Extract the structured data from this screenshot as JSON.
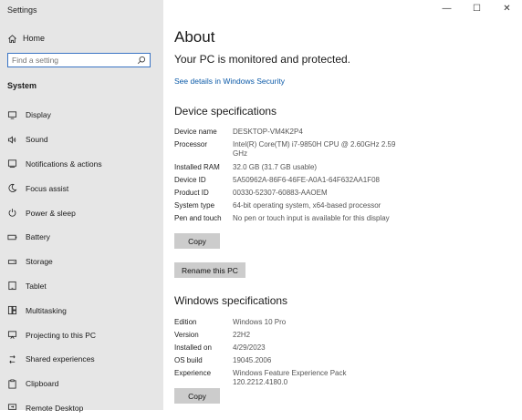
{
  "window": {
    "title": "Settings",
    "controls": {
      "minimize": "—",
      "maximize": "☐",
      "close": "✕"
    }
  },
  "sidebar": {
    "home_label": "Home",
    "search_placeholder": "Find a setting",
    "section": "System",
    "items": [
      {
        "label": "Display",
        "icon": "display-icon"
      },
      {
        "label": "Sound",
        "icon": "sound-icon"
      },
      {
        "label": "Notifications & actions",
        "icon": "notifications-icon"
      },
      {
        "label": "Focus assist",
        "icon": "moon-icon"
      },
      {
        "label": "Power & sleep",
        "icon": "power-icon"
      },
      {
        "label": "Battery",
        "icon": "battery-icon"
      },
      {
        "label": "Storage",
        "icon": "storage-icon"
      },
      {
        "label": "Tablet",
        "icon": "tablet-icon"
      },
      {
        "label": "Multitasking",
        "icon": "multitasking-icon"
      },
      {
        "label": "Projecting to this PC",
        "icon": "projecting-icon"
      },
      {
        "label": "Shared experiences",
        "icon": "shared-icon"
      },
      {
        "label": "Clipboard",
        "icon": "clipboard-icon"
      },
      {
        "label": "Remote Desktop",
        "icon": "remote-desktop-icon"
      }
    ]
  },
  "main": {
    "title": "About",
    "protection": "Your PC is monitored and protected.",
    "security_link": "See details in Windows Security",
    "device": {
      "heading": "Device specifications",
      "rows": [
        {
          "k": "Device name",
          "v": "DESKTOP-VM4K2P4"
        },
        {
          "k": "Processor",
          "v": "Intel(R) Core(TM) i7-9850H CPU @ 2.60GHz   2.59 GHz"
        },
        {
          "k": "Installed RAM",
          "v": "32.0 GB (31.7 GB usable)"
        },
        {
          "k": "Device ID",
          "v": "5A50962A-86F6-46FE-A0A1-64F632AA1F08"
        },
        {
          "k": "Product ID",
          "v": "00330-52307-60883-AAOEM"
        },
        {
          "k": "System type",
          "v": "64-bit operating system, x64-based processor"
        },
        {
          "k": "Pen and touch",
          "v": "No pen or touch input is available for this display"
        }
      ],
      "copy": "Copy",
      "rename": "Rename this PC"
    },
    "windows": {
      "heading": "Windows specifications",
      "rows": [
        {
          "k": "Edition",
          "v": "Windows 10 Pro"
        },
        {
          "k": "Version",
          "v": "22H2"
        },
        {
          "k": "Installed on",
          "v": "4/29/2023"
        },
        {
          "k": "OS build",
          "v": "19045.2006"
        },
        {
          "k": "Experience",
          "v": "Windows Feature Experience Pack 120.2212.4180.0"
        }
      ],
      "copy": "Copy"
    }
  }
}
